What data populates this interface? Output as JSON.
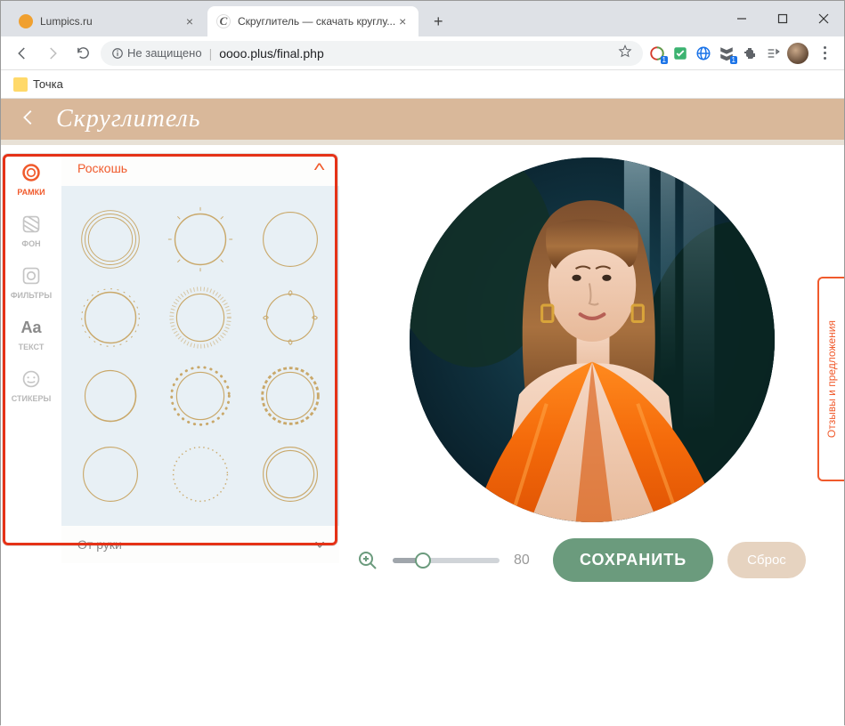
{
  "window": {
    "tabs": [
      {
        "title": "Lumpics.ru",
        "active": false,
        "favicon": "#f0a030"
      },
      {
        "title": "Скруглитель — скачать круглу...",
        "active": true,
        "favicon": "#fff"
      }
    ]
  },
  "toolbar": {
    "insecure_label": "Не защищено",
    "url": "oooo.plus/final.php"
  },
  "bookmarks": {
    "item1": "Точка"
  },
  "app": {
    "brand": "Скруглитель"
  },
  "rail": {
    "frames": "РАМКИ",
    "bg": "ФОН",
    "filters": "ФИЛЬТРЫ",
    "text": "ТЕКСТ",
    "stickers": "СТИКЕРЫ",
    "text_icon": "Aa"
  },
  "panel": {
    "expanded_title": "Роскошь",
    "collapsed_title": "От руки"
  },
  "controls": {
    "zoom_value": "80",
    "save_label": "СОХРАНИТЬ",
    "reset_label": "Сброс"
  },
  "feedback": {
    "label": "Отзывы и предложения"
  }
}
